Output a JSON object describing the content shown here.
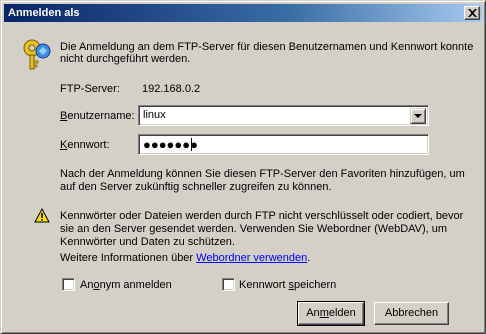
{
  "dialog": {
    "title": "Anmelden als",
    "close_icon": "close-icon"
  },
  "intro": {
    "line1": "Die Anmeldung an dem FTP-Server für diesen Benutzernamen und Kennwort konnte",
    "line2": "nicht durchgeführt werden."
  },
  "server": {
    "label": "FTP-Server:",
    "value": "192.168.0.2"
  },
  "username": {
    "label_pre": "",
    "label_accel": "B",
    "label_post": "enutzername:",
    "value": "linux",
    "dropdown_icon": "chevron-down-icon"
  },
  "password": {
    "label_accel": "K",
    "label_post": "ennwort:",
    "masked_value": "●●●●●●●"
  },
  "favorites_note": {
    "line1": "Nach der Anmeldung können Sie diesen FTP-Server den Favoriten hinzufügen, um",
    "line2": "auf den Server zukünftig schneller zugreifen zu können."
  },
  "warning": {
    "icon": "warning-icon",
    "line1": "Kennwörter oder Dateien werden durch FTP nicht verschlüsselt oder codiert, bevor",
    "line2": "sie an den Server gesendet werden. Verwenden Sie Webordner (WebDAV), um",
    "line3": "Kennwörter und Daten zu schützen.",
    "more_prefix": "Weitere Informationen über ",
    "link_text": "Webordner verwenden",
    "more_suffix": "."
  },
  "options": {
    "anonymous_pre": "An",
    "anonymous_accel": "o",
    "anonymous_post": "nym anmelden",
    "anonymous_checked": false,
    "save_pre": "Kennwort ",
    "save_accel": "s",
    "save_post": "peichern",
    "save_checked": false
  },
  "buttons": {
    "login_pre": "An",
    "login_accel": "m",
    "login_post": "elden",
    "cancel": "Abbrechen"
  }
}
